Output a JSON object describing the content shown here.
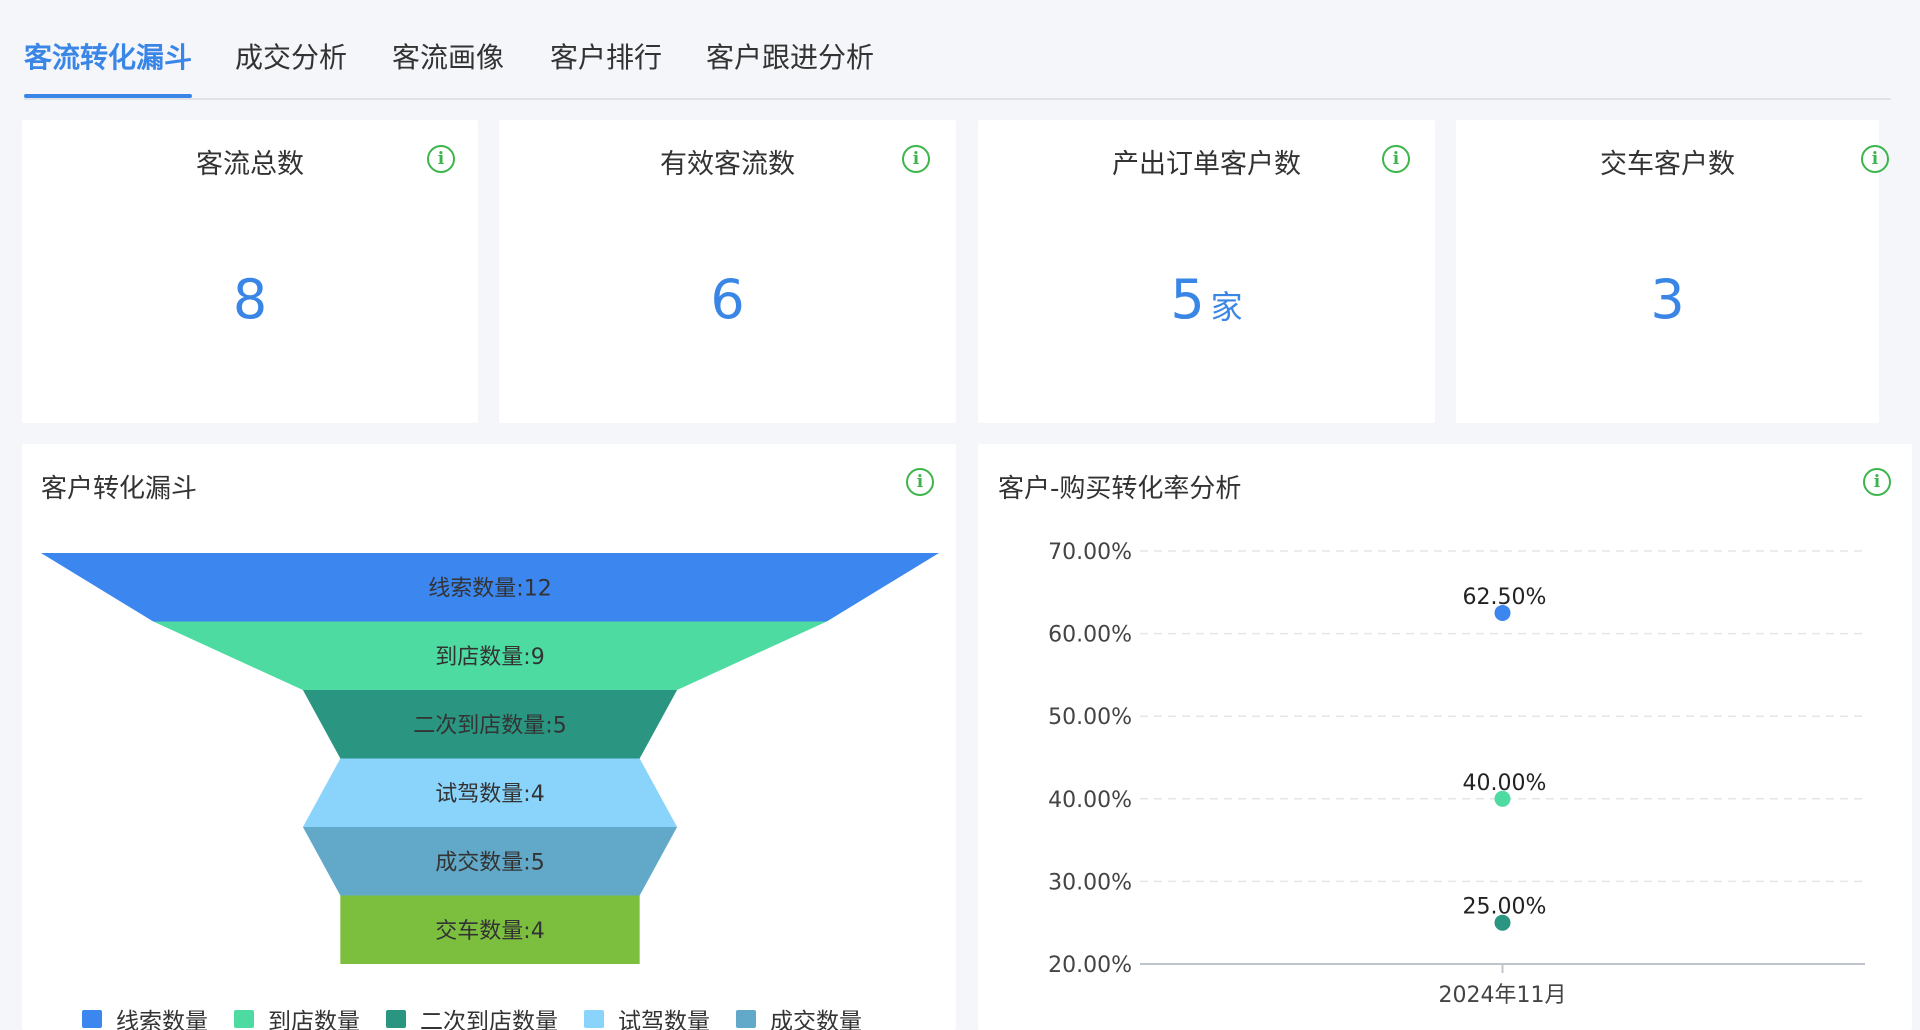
{
  "tabs": [
    {
      "label": "客流转化漏斗",
      "active": true
    },
    {
      "label": "成交分析",
      "active": false
    },
    {
      "label": "客流画像",
      "active": false
    },
    {
      "label": "客户排行",
      "active": false
    },
    {
      "label": "客户跟进分析",
      "active": false
    }
  ],
  "kpis": [
    {
      "title": "客流总数",
      "value": "8",
      "unit": ""
    },
    {
      "title": "有效客流数",
      "value": "6",
      "unit": ""
    },
    {
      "title": "产出订单客户数",
      "value": "5",
      "unit": "家"
    },
    {
      "title": "交车客户数",
      "value": "3",
      "unit": ""
    }
  ],
  "info_glyph": "i",
  "funnel_panel": {
    "title": "客户转化漏斗"
  },
  "rate_panel": {
    "title": "客户-购买转化率分析"
  },
  "colors": {
    "accent": "#3a86e6",
    "info": "#3cb54a"
  },
  "chart_data": [
    {
      "type": "funnel",
      "stages": [
        {
          "name": "线索数量",
          "label": "线索数量:12",
          "value": 12,
          "color": "#3b86ef"
        },
        {
          "name": "到店数量",
          "label": "到店数量:9",
          "value": 9,
          "color": "#4ddba2"
        },
        {
          "name": "二次到店数量",
          "label": "二次到店数量:5",
          "value": 5,
          "color": "#2a9580"
        },
        {
          "name": "试驾数量",
          "label": "试驾数量:4",
          "value": 4,
          "color": "#8ad3fb"
        },
        {
          "name": "成交数量",
          "label": "成交数量:5",
          "value": 5,
          "color": "#62a8c8"
        },
        {
          "name": "交车数量",
          "label": "交车数量:4",
          "value": 4,
          "color": "#7cbf3f"
        }
      ],
      "legend": [
        "线索数量",
        "到店数量",
        "二次到店数量",
        "试驾数量",
        "成交数量"
      ]
    },
    {
      "type": "scatter",
      "categories": [
        "2024年11月"
      ],
      "series": [
        {
          "values": [
            62.5
          ],
          "label": "62.50%",
          "color": "#3b86ef"
        },
        {
          "values": [
            40.0
          ],
          "label": "40.00%",
          "color": "#4ddba2"
        },
        {
          "values": [
            25.0
          ],
          "label": "25.00%",
          "color": "#2a9580"
        }
      ],
      "yticks": [
        "20.00%",
        "30.00%",
        "40.00%",
        "50.00%",
        "60.00%",
        "70.00%"
      ],
      "ylim": [
        20,
        70
      ],
      "grid": true
    }
  ]
}
